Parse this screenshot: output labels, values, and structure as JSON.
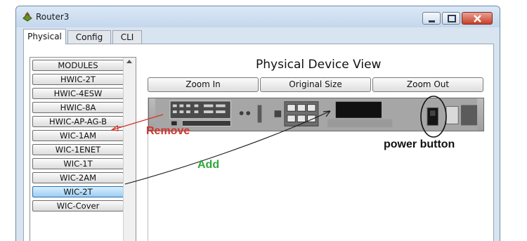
{
  "window": {
    "title": "Router3",
    "app_icon": "router-app-icon",
    "controls": [
      "minimize-icon",
      "maximize-icon",
      "close-icon"
    ]
  },
  "tabs": [
    {
      "label": "Physical",
      "active": true
    },
    {
      "label": "Config",
      "active": false
    },
    {
      "label": "CLI",
      "active": false
    }
  ],
  "modules": {
    "items": [
      "MODULES",
      "HWIC-2T",
      "HWIC-4ESW",
      "HWIC-8A",
      "HWIC-AP-AG-B",
      "WIC-1AM",
      "WIC-1ENET",
      "WIC-1T",
      "WIC-2AM",
      "WIC-2T",
      "WIC-Cover"
    ],
    "selected": "WIC-2T"
  },
  "view": {
    "title": "Physical Device View",
    "zoom_in": "Zoom In",
    "original_size": "Original Size",
    "zoom_out": "Zoom Out"
  },
  "annotations": {
    "remove": "Remove",
    "add": "Add",
    "power": "power button",
    "remove_color": "#d0342c",
    "add_color": "#2fa83a"
  }
}
